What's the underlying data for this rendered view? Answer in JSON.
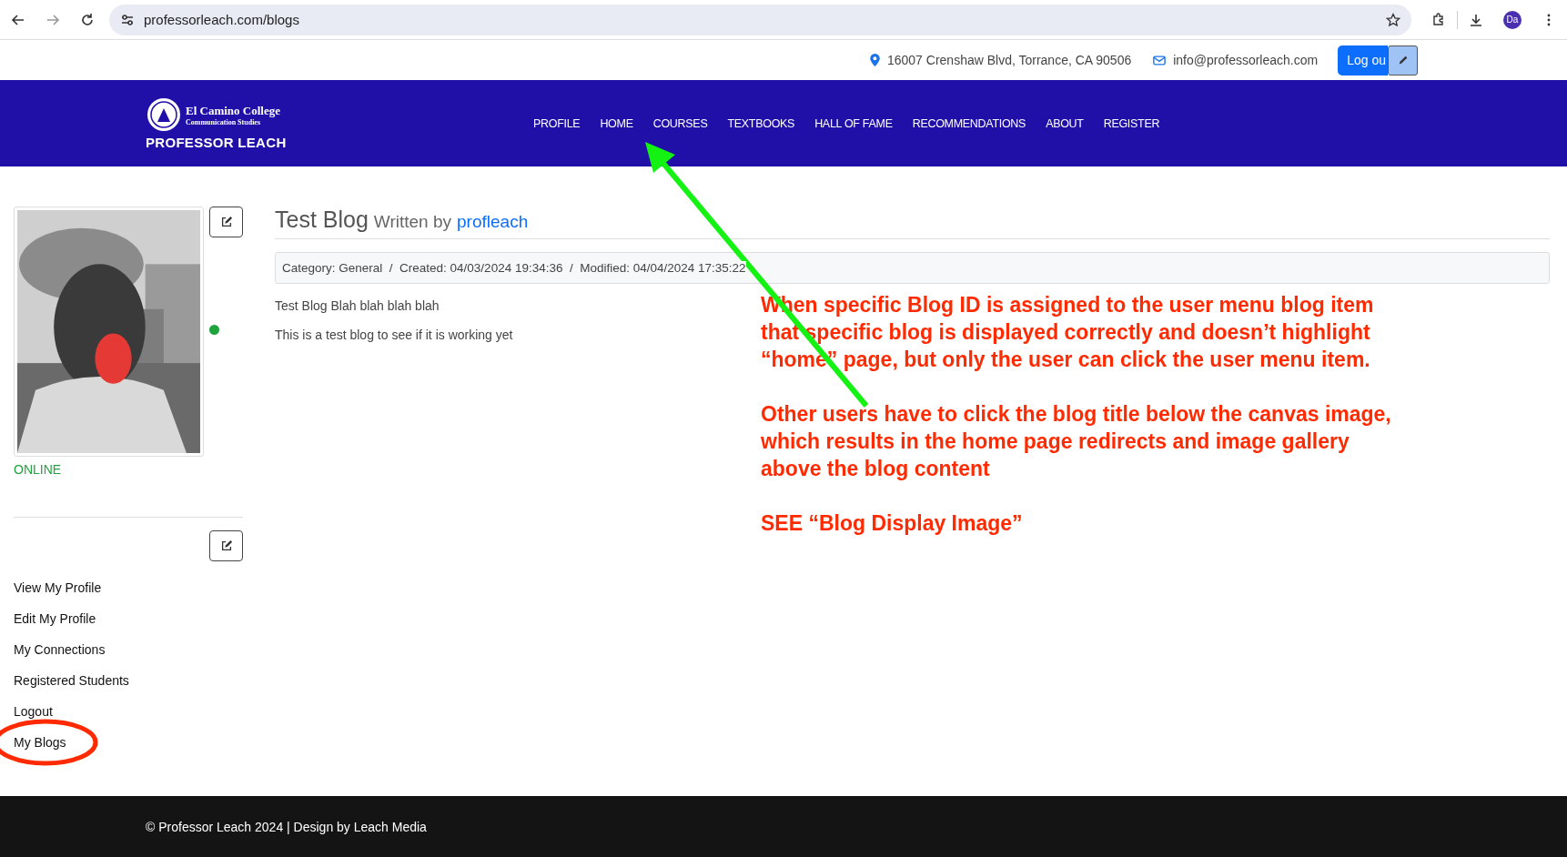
{
  "browser": {
    "url": "professorleach.com/blogs",
    "profile_initials": "Da"
  },
  "topbar": {
    "address": "16007 Crenshaw Blvd, Torrance, CA 90506",
    "email": "info@professorleach.com",
    "logout_label": "Log ou"
  },
  "header": {
    "logo_title": "El Camino College",
    "logo_subtitle": "Communication Studies",
    "logo_name": "PROFESSOR LEACH",
    "nav": [
      {
        "label": "PROFILE",
        "selected": false
      },
      {
        "label": "HOME",
        "selected": false
      },
      {
        "label": "COURSES",
        "selected": false
      },
      {
        "label": "TEXTBOOKS",
        "selected": false
      },
      {
        "label": "HALL OF FAME",
        "selected": false
      },
      {
        "label": "RECOMMENDATIONS",
        "selected": false
      },
      {
        "label": "ABOUT",
        "selected": false
      },
      {
        "label": "REGISTER",
        "selected": false
      }
    ]
  },
  "sidebar": {
    "online": true,
    "status": "ONLINE",
    "menu": [
      "View My Profile",
      "Edit My Profile",
      "My Connections",
      "Registered Students",
      "Logout",
      "My Blogs"
    ]
  },
  "post": {
    "title": "Test Blog",
    "written_by": "Written by",
    "author": "profleach",
    "meta": "Category: General  /  Created: 04/03/2024 19:34:36  /  Modified: 04/04/2024 17:35:22",
    "paragraphs": [
      "Test Blog Blah blah blah blah",
      "This is a test blog to see if it is working yet"
    ]
  },
  "annotation": {
    "paragraphs": [
      "When specific Blog ID is assigned to the user menu blog item that specific blog is displayed correctly and doesn’t highlight “home” page, but only the user can click the user menu item.",
      "Other users have to click the blog title below the canvas image, which results in the home page redirects and image gallery above the blog content",
      "SEE “Blog Display Image”"
    ]
  },
  "footer": {
    "text": "© Professor Leach 2024 | Design by Leach Media"
  }
}
